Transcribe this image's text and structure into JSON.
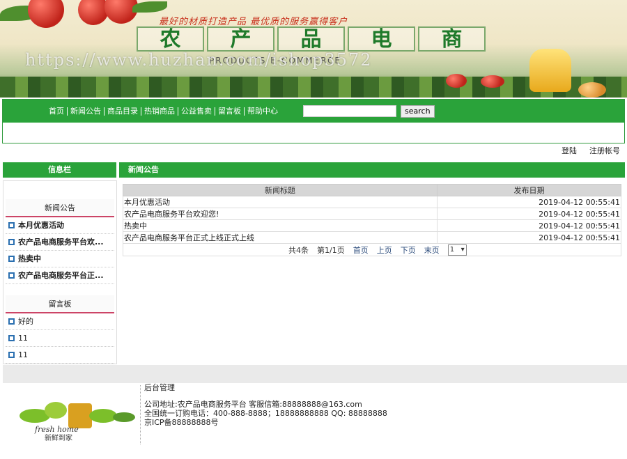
{
  "banner": {
    "slogan": "最好的材质打造产品  最优质的服务赢得客户",
    "brand_chars": [
      "农",
      "产",
      "品",
      "电",
      "商"
    ],
    "brand_sub": "PRODUCTS E-COMMERCE",
    "watermark": "https://www.huzhan.com/ishop3572"
  },
  "nav": {
    "items": [
      "首页",
      "新闻公告",
      "商品目录",
      "热销商品",
      "公益售卖",
      "留言板",
      "帮助中心"
    ],
    "search_placeholder": "",
    "search_button": "search"
  },
  "top_links": {
    "login": "登陆",
    "register": "注册帐号"
  },
  "sidebar": {
    "header": "信息栏",
    "news_title": "新闻公告",
    "news_items": [
      "本月优惠活动",
      "农产品电商服务平台欢...",
      "热卖中",
      "农产品电商服务平台正..."
    ],
    "board_title": "留言板",
    "board_items": [
      "好的",
      "11",
      "11"
    ]
  },
  "main": {
    "header": "新闻公告",
    "columns": [
      "新闻标题",
      "发布日期"
    ],
    "rows": [
      {
        "title": "本月优惠活动",
        "date": "2019-04-12 00:55:41"
      },
      {
        "title": "农产品电商服务平台欢迎您!",
        "date": "2019-04-12 00:55:41"
      },
      {
        "title": "热卖中",
        "date": "2019-04-12 00:55:41"
      },
      {
        "title": "农产品电商服务平台正式上线正式上线",
        "date": "2019-04-12 00:55:41"
      }
    ],
    "pager": {
      "total": "共4条",
      "page_of": "第1/1页",
      "first": "首页",
      "prev": "上页",
      "next": "下页",
      "last": "末页",
      "select_value": "1"
    }
  },
  "footer": {
    "title": "后台管理",
    "address": "公司地址:农产品电商服务平台    客服信箱:88888888@163.com",
    "phone": "全国统一订购电话：400-888-8888；18888888888   QQ: 88888888",
    "icp": "京ICP备88888888号",
    "logo_text": "fresh home",
    "logo_cn": "新鲜到家"
  },
  "colors": {
    "primary_green": "#2aa33a",
    "accent_pink": "#cc4466"
  }
}
